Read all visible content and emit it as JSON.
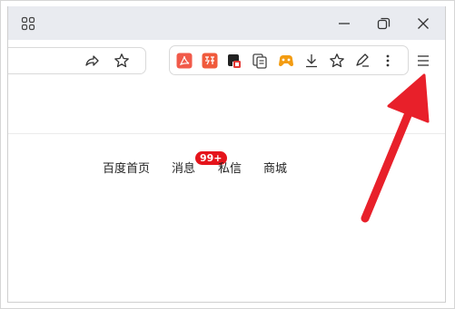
{
  "page": {
    "nav_links": {
      "home": "百度首页",
      "messages": "消息",
      "private_messages": "私信",
      "mall": "商城"
    },
    "message_badge": "99+"
  },
  "colors": {
    "titlebar_bg": "#e9ebf0",
    "annotation_arrow": "#e8202a",
    "badge": "#e5141b"
  },
  "icons": {
    "titlebar": [
      "apps-grid-icon",
      "minimize-icon",
      "restore-icon",
      "close-icon"
    ],
    "address_bar": [
      "share-icon",
      "bookmark-star-icon"
    ],
    "extensions": [
      "pdf-extension-icon",
      "translate-extension-icon",
      "extension-icon",
      "extension-icon",
      "game-extension-icon",
      "download-icon",
      "favorites-star-icon",
      "sign-icon",
      "more-vertical-icon"
    ],
    "menu": "hamburger-menu-icon"
  }
}
